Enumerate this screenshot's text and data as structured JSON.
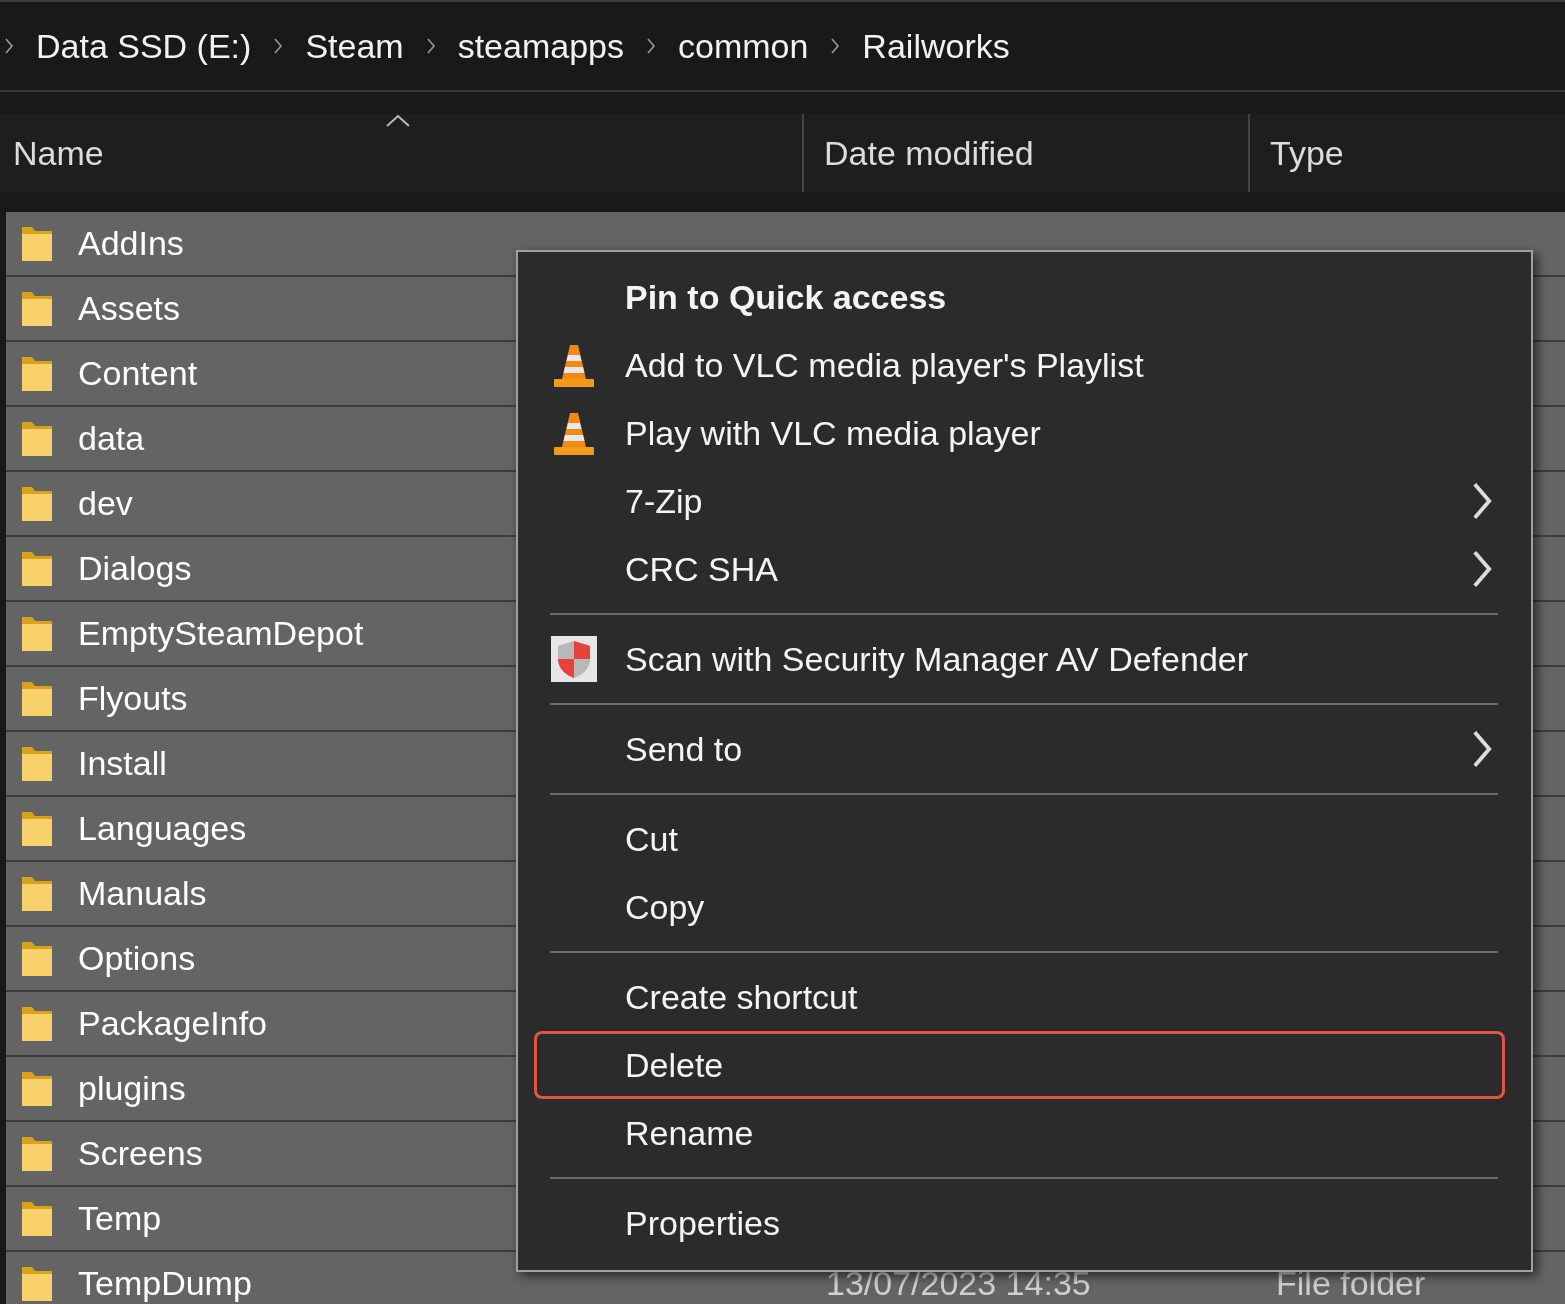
{
  "breadcrumb": [
    "Data SSD (E:)",
    "Steam",
    "steamapps",
    "common",
    "Railworks"
  ],
  "columns": [
    {
      "label": "Name",
      "sorted": true
    },
    {
      "label": "Date modified",
      "sorted": false
    },
    {
      "label": "Type",
      "sorted": false
    }
  ],
  "rows": [
    {
      "name": "AddIns",
      "selected": true
    },
    {
      "name": "Assets",
      "selected": true
    },
    {
      "name": "Content",
      "selected": true
    },
    {
      "name": "data",
      "selected": true
    },
    {
      "name": "dev",
      "selected": true
    },
    {
      "name": "Dialogs",
      "selected": true
    },
    {
      "name": "EmptySteamDepot",
      "selected": true
    },
    {
      "name": "Flyouts",
      "selected": true
    },
    {
      "name": "Install",
      "selected": true
    },
    {
      "name": "Languages",
      "selected": true
    },
    {
      "name": "Manuals",
      "selected": true
    },
    {
      "name": "Options",
      "selected": true
    },
    {
      "name": "PackageInfo",
      "selected": true
    },
    {
      "name": "plugins",
      "selected": true
    },
    {
      "name": "Screens",
      "selected": true
    },
    {
      "name": "Temp",
      "selected": true
    },
    {
      "name": "TempDump",
      "date_modified": "13/07/2023 14:35",
      "type": "File folder",
      "selected": true
    }
  ],
  "context_menu": {
    "items": [
      {
        "kind": "heading",
        "label": "Pin to Quick access",
        "submenu": false,
        "highlighted": false
      },
      {
        "kind": "vlc",
        "label": "Add to VLC media player's Playlist",
        "submenu": false,
        "highlighted": false
      },
      {
        "kind": "vlc",
        "label": "Play with VLC media player",
        "submenu": false,
        "highlighted": false
      },
      {
        "kind": "plain",
        "label": "7-Zip",
        "submenu": true,
        "highlighted": false
      },
      {
        "kind": "plain",
        "label": "CRC SHA",
        "submenu": true,
        "highlighted": false
      },
      {
        "kind": "separator"
      },
      {
        "kind": "shield",
        "label": "Scan with Security Manager AV Defender",
        "submenu": false,
        "highlighted": false
      },
      {
        "kind": "separator"
      },
      {
        "kind": "plain",
        "label": "Send to",
        "submenu": true,
        "highlighted": false
      },
      {
        "kind": "separator"
      },
      {
        "kind": "plain",
        "label": "Cut",
        "submenu": false,
        "highlighted": false
      },
      {
        "kind": "plain",
        "label": "Copy",
        "submenu": false,
        "highlighted": false
      },
      {
        "kind": "separator"
      },
      {
        "kind": "plain",
        "label": "Create shortcut",
        "submenu": false,
        "highlighted": false
      },
      {
        "kind": "plain",
        "label": "Delete",
        "submenu": false,
        "highlighted": true
      },
      {
        "kind": "plain",
        "label": "Rename",
        "submenu": false,
        "highlighted": false
      },
      {
        "kind": "separator"
      },
      {
        "kind": "plain",
        "label": "Properties",
        "submenu": false,
        "highlighted": false
      }
    ]
  }
}
